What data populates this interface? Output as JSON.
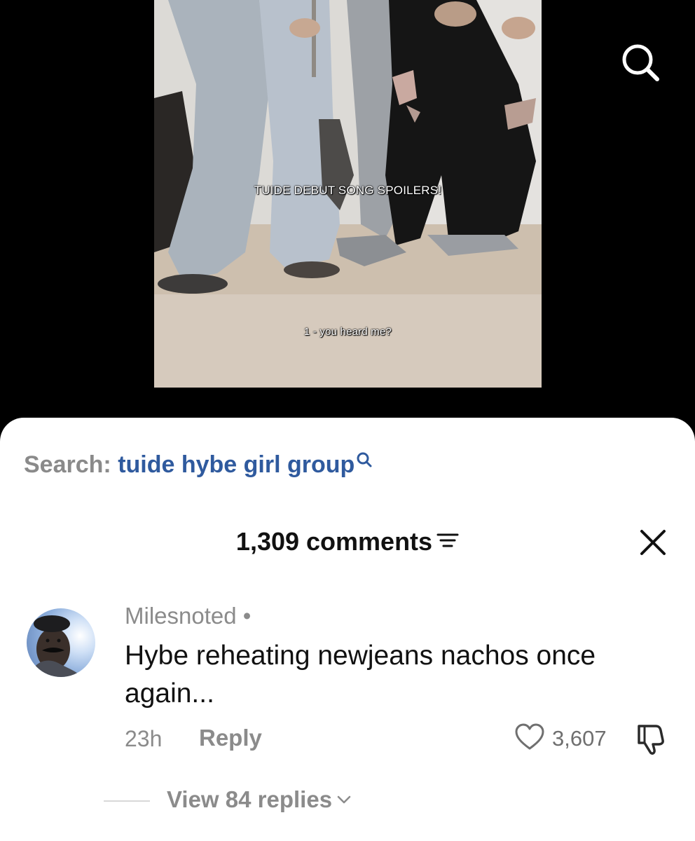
{
  "video": {
    "caption_title": "TUIDE DEBUT SONG SPOILERS!",
    "caption_sub": "1 - you heard me?"
  },
  "top_bar": {
    "search_icon": "search-icon"
  },
  "comments_sheet": {
    "search_prefix": "Search:",
    "search_term": "tuide hybe girl group",
    "header_title": "1,309 comments",
    "icons": {
      "filter": "filter-icon",
      "close": "close-icon"
    }
  },
  "comment": {
    "username": "Milesnoted •",
    "text": "Hybe reheating newjeans nachos once again...",
    "time": "23h",
    "reply_label": "Reply",
    "likes": "3,607",
    "view_replies_label": "View 84 replies"
  },
  "colors": {
    "search_term": "#2f5a9e",
    "muted_text": "#8b8b8b",
    "sheet_bg": "#ffffff",
    "backdrop": "#000000"
  }
}
